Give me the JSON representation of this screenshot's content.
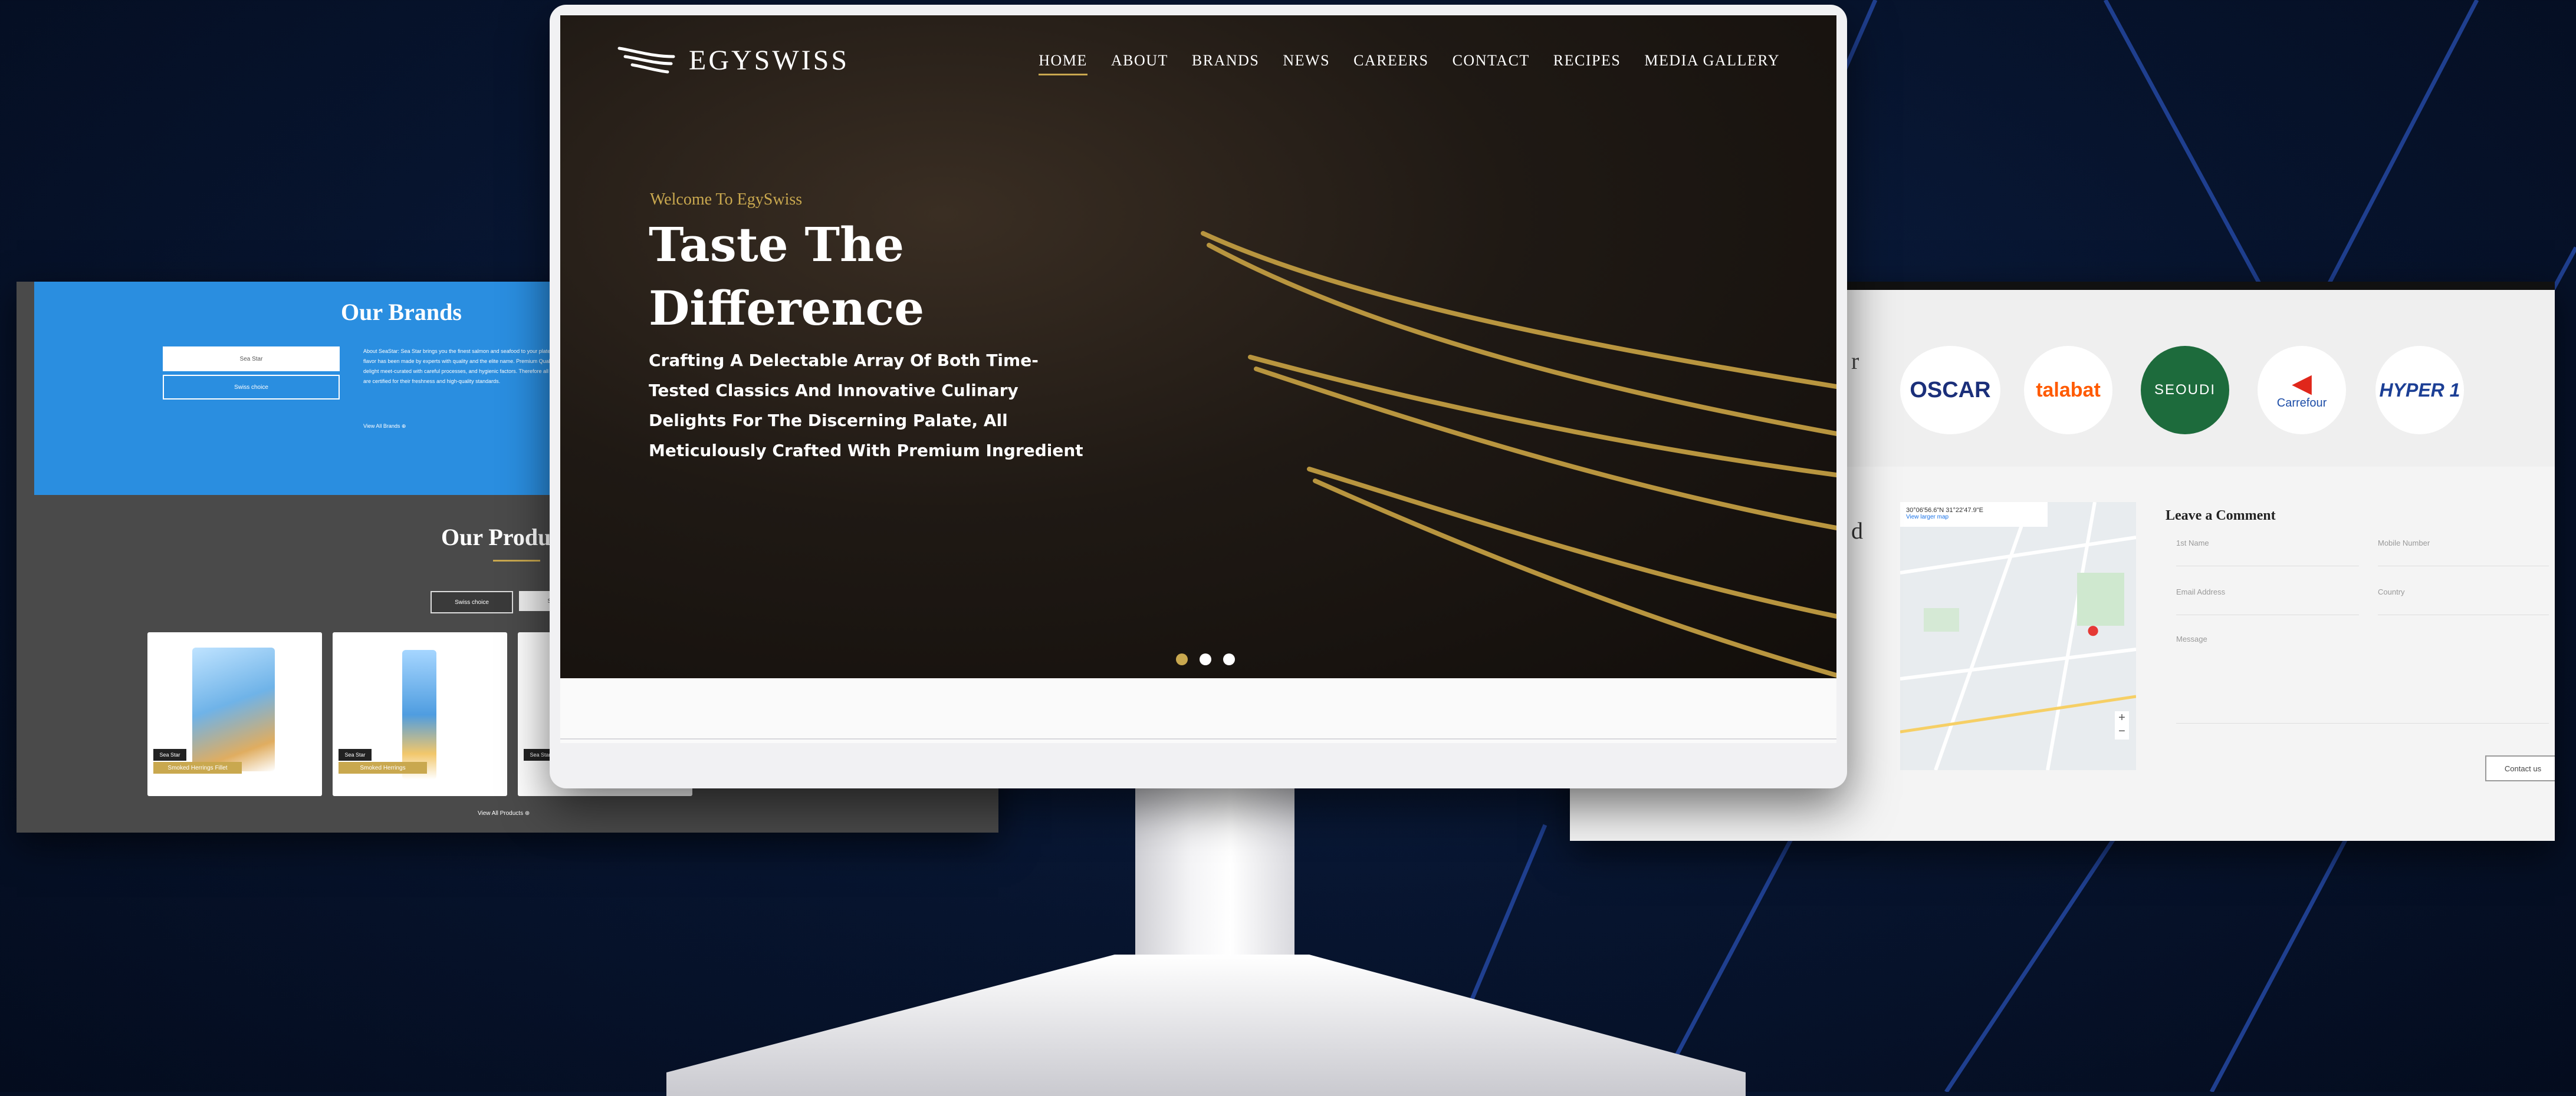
{
  "site": {
    "brand": "EGYSWISS",
    "nav": [
      "HOME",
      "ABOUT",
      "BRANDS",
      "NEWS",
      "CAREERS",
      "CONTACT",
      "RECIPES",
      "MEDIA GALLERY"
    ],
    "active_nav": "HOME"
  },
  "hero": {
    "welcome": "Welcome To EgySwiss",
    "title": "Taste The Difference",
    "subtitle": "Crafting A Delectable Array Of Both Time-Tested Classics And Innovative Culinary Delights For The Discerning Palate, All Meticulously Crafted With Premium Ingredient",
    "slides_count": 3,
    "active_slide": 1
  },
  "left_panel": {
    "brands_title": "Our Brands",
    "btn_white": "Sea Star",
    "btn_outline": "Swiss choice",
    "paragraph": "About SeaStar: Sea Star brings you the finest salmon and seafood to your plate. A unique flavor has been made by experts with quality and the elite name. Premium Quality SeaStar delight meet-curated with careful processes, and hygienic factors. Therefore all the products are certified for their freshness and high-quality standards.",
    "view_brands": "View All Brands ⊕",
    "products_title": "Our Products",
    "filter_dark": "Swiss choice",
    "filter_light": "Sea Star",
    "products": [
      {
        "badge": "Sea Star",
        "caption": "Smoked Herrings Fillet"
      },
      {
        "badge": "Sea Star",
        "caption": "Smoked Herrings"
      },
      {
        "badge": "Sea Star",
        "caption": ""
      }
    ],
    "view_products": "View All Products ⊕"
  },
  "right_panel": {
    "partners": [
      "OSCAR",
      "talabat",
      "SEOUDI",
      "Carrefour",
      "HYPER 1"
    ],
    "heading_letter": "r",
    "heading_letter_2": "d",
    "map_coords": "30°06'56.6\"N 31°22'47.9\"E",
    "map_link": "View larger map",
    "comment_title": "Leave a Comment",
    "fields": {
      "first_name": "1st Name",
      "mobile": "Mobile Number",
      "email": "Email Address",
      "country": "Country",
      "message": "Message"
    },
    "contact_btn": "Contact us"
  },
  "colors": {
    "background": "#07142e",
    "accent_gold": "#c9a84f",
    "brands_blue": "#2a8ee0",
    "stripe_blue": "#1f3f8f"
  }
}
